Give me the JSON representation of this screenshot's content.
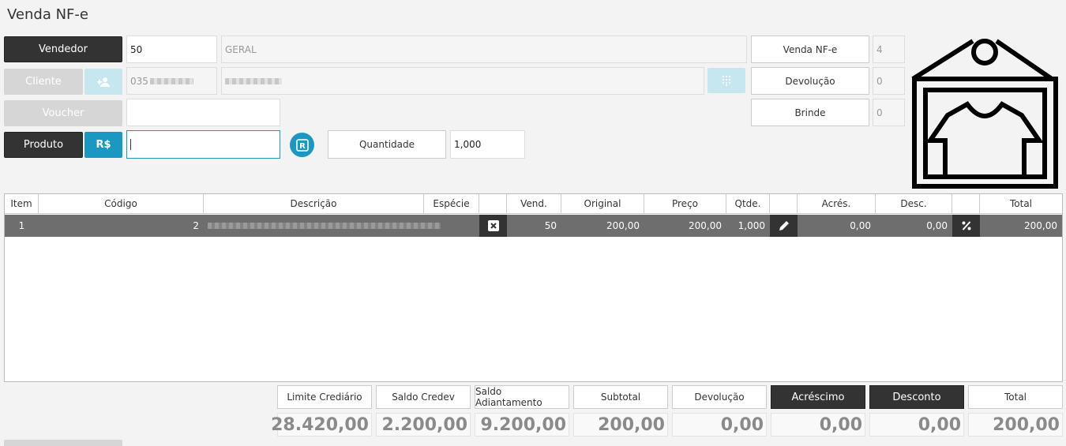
{
  "title": "Venda NF-e",
  "form": {
    "vendedor_label": "Vendedor",
    "vendedor_code": "50",
    "vendedor_name": "GERAL",
    "cliente_label": "Cliente",
    "cliente_code": "035",
    "voucher_label": "Voucher",
    "produto_label": "Produto",
    "rs_label": "R$",
    "quantidade_label": "Quantidade",
    "quantidade_value": "1,000"
  },
  "counters": [
    {
      "label": "Venda NF-e",
      "value": "4"
    },
    {
      "label": "Devolução",
      "value": "0"
    },
    {
      "label": "Brinde",
      "value": "0"
    }
  ],
  "table": {
    "headers": {
      "item": "Item",
      "codigo": "Código",
      "descricao": "Descrição",
      "especie": "Espécie",
      "vend": "Vend.",
      "original": "Original",
      "preco": "Preço",
      "qtde": "Qtde.",
      "acres": "Acrés.",
      "desc": "Desc.",
      "total": "Total"
    },
    "rows": [
      {
        "item": "1",
        "codigo": "2",
        "vend": "50",
        "original": "200,00",
        "preco": "200,00",
        "qtde": "1,000",
        "acres": "0,00",
        "desc": "0,00",
        "total": "200,00"
      }
    ]
  },
  "summary": [
    {
      "label": "Limite Crediário",
      "value": "28.420,00"
    },
    {
      "label": "Saldo Credev",
      "value": "2.200,00"
    },
    {
      "label": "Saldo Adiantamento",
      "value": "9.200,00"
    },
    {
      "label": "Subtotal",
      "value": "200,00"
    },
    {
      "label": "Devolução",
      "value": "0,00"
    },
    {
      "label": "Acréscimo",
      "value": "0,00"
    },
    {
      "label": "Desconto",
      "value": "0,00"
    },
    {
      "label": "Total",
      "value": "200,00"
    }
  ]
}
